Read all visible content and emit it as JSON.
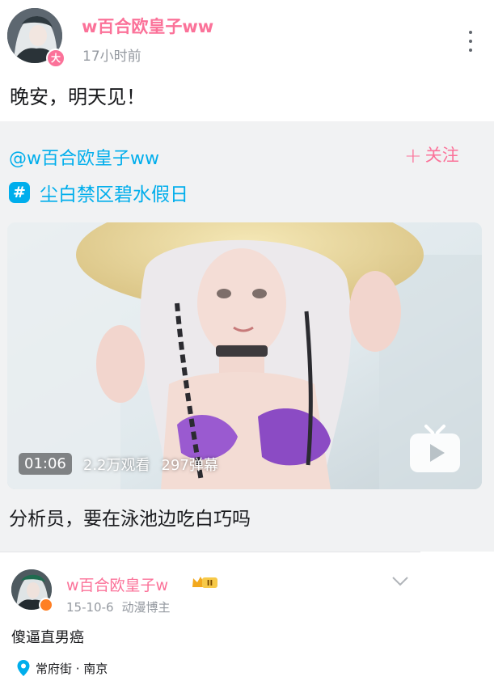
{
  "post": {
    "author": "w百合欧皇子ww",
    "level_badge": "大",
    "time": "17小时前",
    "text": "晚安，明天见！",
    "more_icon": "more-vertical-icon"
  },
  "repost": {
    "origin_author": "@w百合欧皇子ww",
    "follow_label": "关注",
    "follow_plus": "+",
    "topic_icon": "#",
    "topic": "尘白禁区碧水假日",
    "video": {
      "duration": "01:06",
      "views": "2.2万观看",
      "danmaku": "297弹幕",
      "play_icon": "tv-play-icon"
    },
    "title": "分析员，要在泳池边吃白巧吗"
  },
  "comment": {
    "author": "w百合欧皇子w",
    "date": "15-10-6",
    "tag": "动漫博主",
    "text": "傻逼直男癌",
    "location": "常府街 · 南京"
  },
  "colors": {
    "pink": "#fb7299",
    "blue": "#00aeec",
    "gray_text": "#9499a0",
    "card_bg": "#f1f2f3"
  }
}
